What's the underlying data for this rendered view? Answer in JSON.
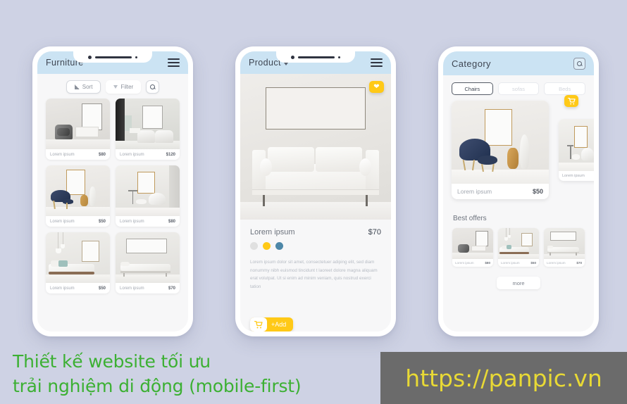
{
  "background_color": "#ced2e4",
  "accent_yellow": "#ffc917",
  "appbar_color": "#cbe3f3",
  "phone1": {
    "title": "Furniture",
    "menu_icon": "hamburger-icon",
    "toolbar": {
      "sort_label": "Sort",
      "filter_label": "Filter",
      "search_icon": "search-icon"
    },
    "products": [
      {
        "name": "Lorem ipsum",
        "price": "$80"
      },
      {
        "name": "Lorem ipsum",
        "price": "$120"
      },
      {
        "name": "Lorem ipsum",
        "price": "$50"
      },
      {
        "name": "Lorem ipsum",
        "price": "$80"
      },
      {
        "name": "Lorem ipsum",
        "price": "$50"
      },
      {
        "name": "Lorem ipsum",
        "price": "$70"
      }
    ]
  },
  "phone2": {
    "title": "Product",
    "menu_icon": "hamburger-icon",
    "favorite_icon": "heart-icon",
    "detail": {
      "name": "Lorem ipsum",
      "price": "$70",
      "swatches": [
        "#e0e0e0",
        "#ffc917",
        "#4d87a8"
      ],
      "description": "Lorem ipsum dolor sit amet, consectetuer adiping elit, sed diam nonummy nibh euismod tincidunt t laoreet dolore magna aliquam erat volutpat. Ut si enim ad minim veniam, quis nostrud exerci tation",
      "cart_icon": "shopping-cart-icon",
      "add_label": "+Add"
    }
  },
  "phone3": {
    "title": "Category",
    "search_icon": "search-icon",
    "chips": [
      {
        "label": "Chairs",
        "active": true
      },
      {
        "label": "sofas",
        "active": false
      },
      {
        "label": "Beds",
        "active": false
      }
    ],
    "featured": {
      "name": "Lorem ipsum",
      "price": "$50",
      "cart_icon": "shopping-cart-icon"
    },
    "side": {
      "name": "Lorem ipsum",
      "price": "$"
    },
    "section_title": "Best offers",
    "offers": [
      {
        "name": "Lorem ipsum",
        "price": "$80"
      },
      {
        "name": "Lorem ipsum",
        "price": "$50"
      },
      {
        "name": "Lorem ipsum",
        "price": "$70"
      }
    ],
    "more_label": "more"
  },
  "caption": "Thiết kế website tối ưu\ntrải nghiệm di động (mobile-first)",
  "caption_color": "#3cb033",
  "watermark": "https://panpic.vn",
  "watermark_color": "#e8d935"
}
